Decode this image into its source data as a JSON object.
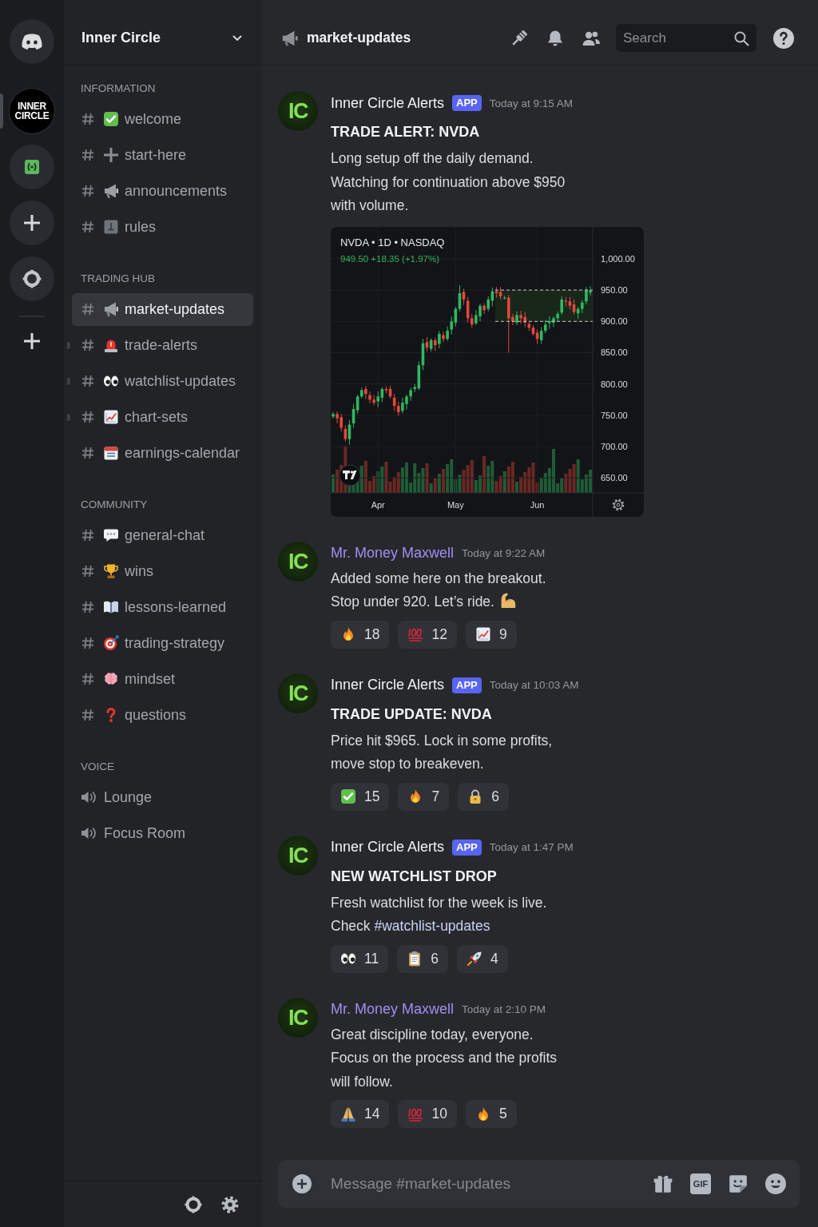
{
  "servers": [
    {
      "kind": "home",
      "selected": false
    },
    {
      "kind": "logo",
      "label": "INNER CIRCLE",
      "selected": true
    },
    {
      "kind": "money",
      "selected": false
    },
    {
      "kind": "add",
      "selected": false
    },
    {
      "kind": "ring",
      "selected": false
    },
    {
      "kind": "plus",
      "selected": false
    }
  ],
  "server_header": {
    "name": "Inner Circle"
  },
  "categories": [
    {
      "name": "INFORMATION",
      "channels": [
        {
          "kind": "text",
          "icon": {
            "kind": "check"
          },
          "name": "welcome",
          "selected": false,
          "unread": false
        },
        {
          "kind": "text",
          "icon": {
            "kind": "cross"
          },
          "name": "start-here",
          "selected": false,
          "unread": false
        },
        {
          "kind": "text",
          "icon": {
            "kind": "megaphone"
          },
          "name": "announcements",
          "selected": false,
          "unread": false
        },
        {
          "kind": "text",
          "icon": {
            "kind": "notice"
          },
          "name": "rules",
          "selected": false,
          "unread": false
        }
      ]
    },
    {
      "name": "TRADING HUB",
      "channels": [
        {
          "kind": "text",
          "icon": {
            "kind": "megaphone"
          },
          "name": "market-updates",
          "selected": true,
          "unread": false
        },
        {
          "kind": "text",
          "icon": {
            "kind": "siren"
          },
          "name": "trade-alerts",
          "selected": false,
          "unread": true
        },
        {
          "kind": "text",
          "icon": {
            "kind": "eyes"
          },
          "name": "watchlist-updates",
          "selected": false,
          "unread": true
        },
        {
          "kind": "text",
          "icon": {
            "kind": "chart"
          },
          "name": "chart-sets",
          "selected": false,
          "unread": true
        },
        {
          "kind": "text",
          "icon": {
            "kind": "calendar"
          },
          "name": "earnings-calendar",
          "selected": false,
          "unread": false
        }
      ]
    },
    {
      "name": "COMMUNITY",
      "channels": [
        {
          "kind": "text",
          "icon": {
            "kind": "speech"
          },
          "name": "general-chat",
          "selected": false,
          "unread": false
        },
        {
          "kind": "text",
          "icon": {
            "kind": "trophy"
          },
          "name": "wins",
          "selected": false,
          "unread": false
        },
        {
          "kind": "text",
          "icon": {
            "kind": "book"
          },
          "name": "lessons-learned",
          "selected": false,
          "unread": false
        },
        {
          "kind": "text",
          "icon": {
            "kind": "target"
          },
          "name": "trading-strategy",
          "selected": false,
          "unread": false
        },
        {
          "kind": "text",
          "icon": {
            "kind": "brain"
          },
          "name": "mindset",
          "selected": false,
          "unread": false
        },
        {
          "kind": "text",
          "icon": {
            "kind": "question"
          },
          "name": "questions",
          "selected": false,
          "unread": false
        }
      ]
    },
    {
      "name": "VOICE",
      "channels": [
        {
          "kind": "voice",
          "name": "Lounge",
          "selected": false,
          "unread": false
        },
        {
          "kind": "voice",
          "name": "Focus Room",
          "selected": false,
          "unread": false
        }
      ]
    }
  ],
  "channel_header": {
    "name": "market-updates"
  },
  "search": {
    "placeholder": "Search"
  },
  "messages": [
    {
      "avatar": "IC",
      "author": "Inner Circle Alerts",
      "color": "#f2f3f5",
      "badge": "APP",
      "time": "Today at 9:15 AM",
      "title": "TRADE ALERT: NVDA",
      "body": "Long setup off the daily demand.\nWatching for continuation above $950\nwith volume.",
      "chart": {
        "quote": "949.50 +18.35 (+1.97%)",
        "chart_data": {
          "type": "candlestick",
          "title": "NVDA • 1D • NASDAQ",
          "categories": [
            null,
            null,
            null,
            null,
            null,
            null,
            null,
            null,
            null,
            null,
            null,
            "Apr",
            null,
            null,
            null,
            null,
            null,
            null,
            null,
            null,
            null,
            null,
            null,
            null,
            null,
            null,
            null,
            null,
            null,
            null,
            "May",
            null,
            null,
            null,
            null,
            null,
            null,
            null,
            null,
            null,
            null,
            null,
            null,
            null,
            null,
            null,
            null,
            null,
            null,
            null,
            "Jun",
            null,
            null,
            null,
            null,
            null,
            null,
            null,
            null,
            null,
            null,
            null,
            null,
            null
          ],
          "ohlc": [
            [
              748,
              755,
              745,
              752
            ],
            [
              752,
              756,
              737,
              745
            ],
            [
              747,
              752,
              724,
              730
            ],
            [
              728,
              734,
              708,
              712
            ],
            [
              712,
              742,
              703,
              735
            ],
            [
              737,
              768,
              730,
              760
            ],
            [
              758,
              783,
              753,
              780
            ],
            [
              780,
              794,
              777,
              790
            ],
            [
              792,
              797,
              776,
              784
            ],
            [
              782,
              788,
              769,
              775
            ],
            [
              775,
              782,
              766,
              770
            ],
            [
              772,
              788,
              763,
              780
            ],
            [
              778,
              795,
              771,
              792
            ],
            [
              792,
              796,
              785,
              790
            ],
            [
              792,
              797,
              777,
              780
            ],
            [
              778,
              784,
              757,
              765
            ],
            [
              765,
              772,
              749,
              755
            ],
            [
              757,
              778,
              753,
              770
            ],
            [
              768,
              783,
              759,
              780
            ],
            [
              780,
              794,
              773,
              790
            ],
            [
              792,
              800,
              787,
              795
            ],
            [
              793,
              836,
              790,
              830
            ],
            [
              830,
              872,
              822,
              865
            ],
            [
              867,
              875,
              852,
              858
            ],
            [
              856,
              873,
              852,
              870
            ],
            [
              870,
              874,
              853,
              862
            ],
            [
              864,
              885,
              857,
              880
            ],
            [
              878,
              884,
              867,
              872
            ],
            [
              872,
              892,
              869,
              885
            ],
            [
              887,
              908,
              879,
              900
            ],
            [
              898,
              923,
              892,
              920
            ],
            [
              920,
              958,
              916,
              945
            ],
            [
              947,
              952,
              926,
              935
            ],
            [
              933,
              939,
              898,
              905
            ],
            [
              905,
              912,
              890,
              895
            ],
            [
              897,
              918,
              894,
              910
            ],
            [
              908,
              928,
              900,
              925
            ],
            [
              925,
              929,
              912,
              918
            ],
            [
              920,
              940,
              916,
              935
            ],
            [
              933,
              954,
              924,
              948
            ],
            [
              948,
              955,
              938,
              945
            ],
            [
              947,
              955,
              935,
              940
            ],
            [
              938,
              941,
              935,
              938
            ],
            [
              938,
              942,
              850,
              905
            ],
            [
              907,
              912,
              894,
              900
            ],
            [
              898,
              916,
              894,
              910
            ],
            [
              910,
              917,
              896,
              905
            ],
            [
              907,
              915,
              891,
              898
            ],
            [
              896,
              899,
              885,
              890
            ],
            [
              890,
              894,
              877,
              880
            ],
            [
              882,
              887,
              864,
              872
            ],
            [
              870,
              891,
              864,
              885
            ],
            [
              885,
              902,
              881,
              895
            ],
            [
              897,
              908,
              888,
              900
            ],
            [
              898,
              908,
              891,
              905
            ],
            [
              905,
              916,
              900,
              912
            ],
            [
              914,
              940,
              911,
              935
            ],
            [
              933,
              939,
              924,
              932
            ],
            [
              932,
              939,
              919,
              925
            ],
            [
              927,
              935,
              911,
              915
            ],
            [
              913,
              923,
              904,
              920
            ],
            [
              920,
              934,
              913,
              930
            ],
            [
              932,
              955,
              927,
              950
            ],
            [
              946,
              956,
              941,
              949.5
            ]
          ],
          "ylim": [
            626,
            1051
          ],
          "yticks": [
            {
              "value": 1000,
              "label": "1,000.00"
            },
            {
              "value": 950,
              "label": "950.00"
            },
            {
              "value": 900,
              "label": "900.00"
            },
            {
              "value": 850,
              "label": "850.00"
            },
            {
              "value": 800,
              "label": "800.00"
            },
            {
              "value": 750,
              "label": "750.00"
            },
            {
              "value": 700,
              "label": "700.00"
            },
            {
              "value": 650,
              "label": "650.00"
            }
          ],
          "grid": true,
          "ref_lines": [
            {
              "axis": "y",
              "value": 950
            },
            {
              "axis": "y",
              "value": 900
            }
          ],
          "bands": [
            {
              "axis": "y",
              "from": 900,
              "to": 950
            }
          ]
        }
      }
    },
    {
      "avatar": "IC",
      "author": "Mr. Money Maxwell",
      "color": "#a28ef0",
      "time": "Today at 9:22 AM",
      "body": "Added some here on the breakout.\nStop under 920. Let’s ride.",
      "trailing_icon": {
        "kind": "muscle"
      },
      "reactions": [
        {
          "kind": "fire",
          "count": "18"
        },
        {
          "kind": "hundred",
          "count": "12"
        },
        {
          "kind": "chart",
          "count": "9"
        }
      ]
    },
    {
      "avatar": "IC",
      "author": "Inner Circle Alerts",
      "color": "#f2f3f5",
      "badge": "APP",
      "time": "Today at 10:03 AM",
      "title": "TRADE UPDATE: NVDA",
      "body": "Price hit $965. Lock in some profits,\nmove stop to breakeven.",
      "reactions": [
        {
          "kind": "check",
          "count": "15"
        },
        {
          "kind": "fire",
          "count": "7"
        },
        {
          "kind": "lock",
          "count": "6"
        }
      ]
    },
    {
      "avatar": "IC",
      "author": "Inner Circle Alerts",
      "color": "#f2f3f5",
      "badge": "APP",
      "time": "Today at 1:47 PM",
      "title": "NEW WATCHLIST DROP",
      "body": "Fresh watchlist for the week is live.\nCheck ",
      "mention": "#watchlist-updates",
      "reactions": [
        {
          "kind": "eyes",
          "count": "11"
        },
        {
          "kind": "clipboard",
          "count": "6"
        },
        {
          "kind": "rocket",
          "count": "4"
        }
      ]
    },
    {
      "avatar": "IC",
      "author": "Mr. Money Maxwell",
      "color": "#a28ef0",
      "time": "Today at 2:10 PM",
      "body": "Great discipline today, everyone.\nFocus on the process and the profits\nwill follow.",
      "reactions": [
        {
          "kind": "pray",
          "count": "14"
        },
        {
          "kind": "hundred",
          "count": "10"
        },
        {
          "kind": "fire",
          "count": "5"
        }
      ]
    }
  ],
  "composer": {
    "placeholder": "Message #market-updates",
    "gif": "GIF"
  }
}
